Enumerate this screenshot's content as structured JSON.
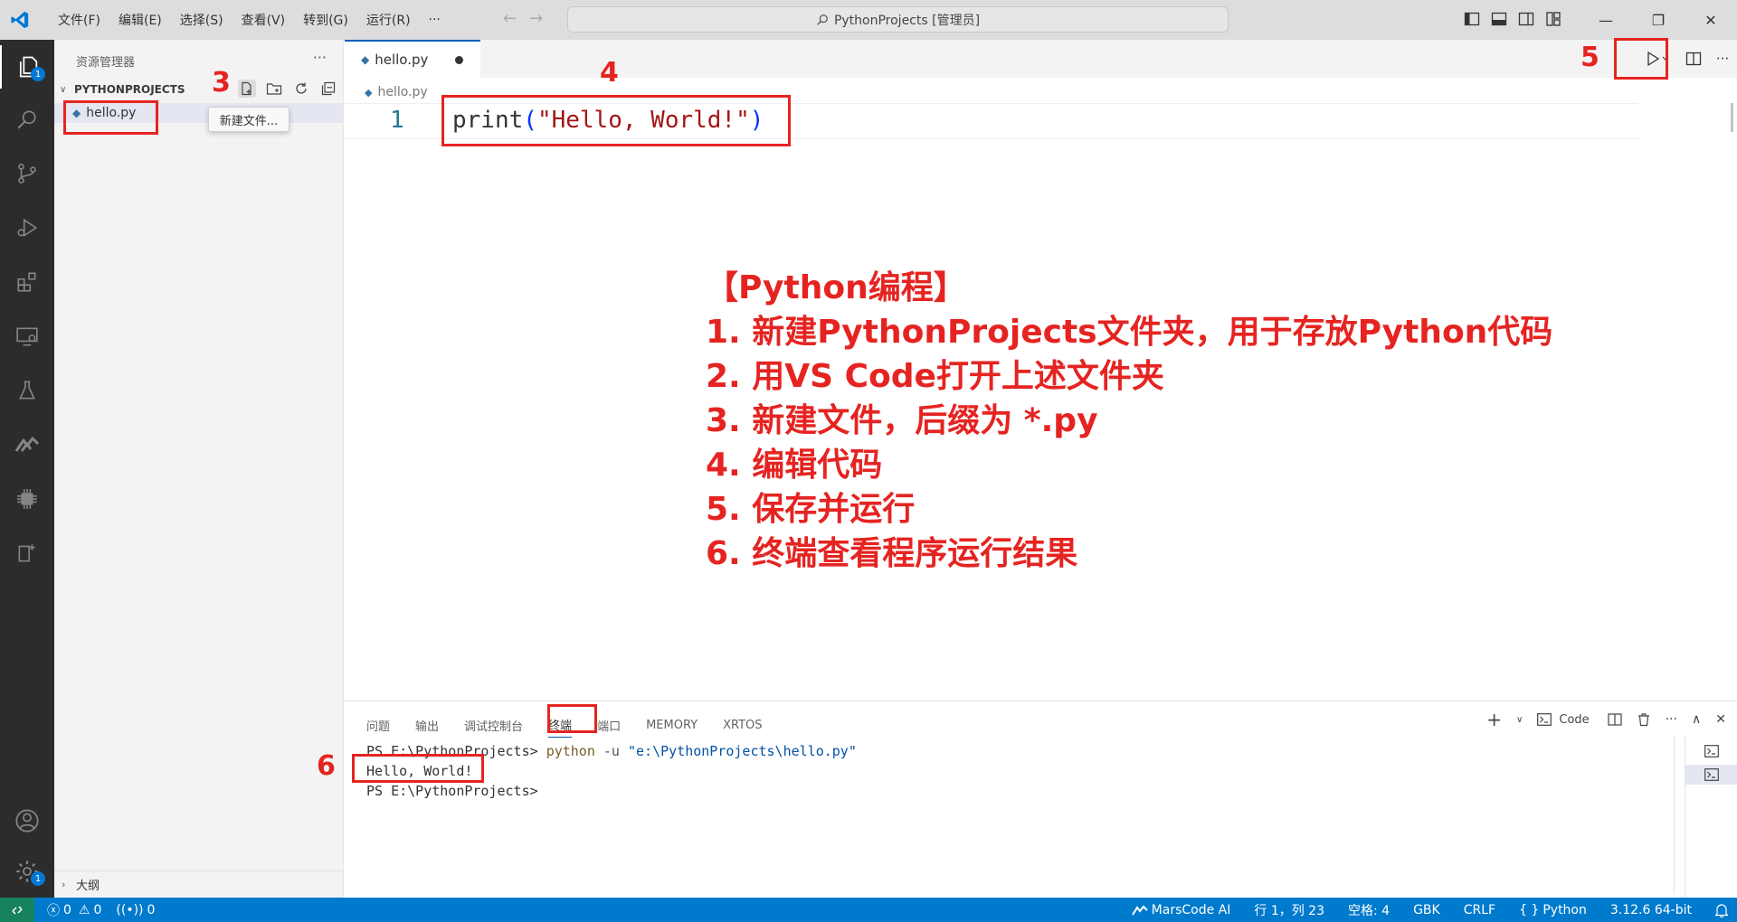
{
  "titlebar": {
    "menus": [
      "文件(F)",
      "编辑(E)",
      "选择(S)",
      "查看(V)",
      "转到(G)",
      "运行(R)",
      "···"
    ],
    "search_text": "PythonProjects [管理员]"
  },
  "activity": {
    "explorer_badge": "1",
    "manage_badge": "1"
  },
  "sidebar": {
    "title": "资源管理器",
    "project": "PYTHONPROJECTS",
    "file": "hello.py",
    "tooltip": "新建文件...",
    "outline": "大纲"
  },
  "editor": {
    "tab_name": "hello.py",
    "breadcrumb": "hello.py",
    "line_number": "1",
    "code": {
      "fn": "print",
      "open": "(",
      "str": "\"Hello, World!\"",
      "close": ")"
    }
  },
  "instructions": [
    "【Python编程】",
    "1. 新建PythonProjects文件夹，用于存放Python代码",
    "2. 用VS Code打开上述文件夹",
    "3. 新建文件，后缀为 *.py",
    "4. 编辑代码",
    "5. 保存并运行",
    "6. 终端查看程序运行结果"
  ],
  "annotations": [
    "3",
    "4",
    "5",
    "6"
  ],
  "panel": {
    "tabs": [
      "问题",
      "输出",
      "调试控制台",
      "终端",
      "端口",
      "MEMORY",
      "XRTOS"
    ],
    "active_tab": "终端",
    "code_label": "Code",
    "terminal": {
      "prompt1": "PS E:\\PythonProjects> ",
      "cmd": "python",
      "arg": " -u ",
      "path": "\"e:\\PythonProjects\\hello.py\"",
      "output": "Hello, World!",
      "prompt2": "PS E:\\PythonProjects>"
    }
  },
  "status": {
    "errors": "0",
    "warnings": "0",
    "ports": "0",
    "marscode": "MarsCode AI",
    "position": "行 1，列 23",
    "spaces": "空格: 4",
    "encoding": "GBK",
    "eol": "CRLF",
    "language": "Python",
    "interpreter": "3.12.6 64-bit"
  },
  "colors": {
    "accent": "#007acc",
    "annotation": "#e52421",
    "activity_bg": "#2c2c2c"
  }
}
